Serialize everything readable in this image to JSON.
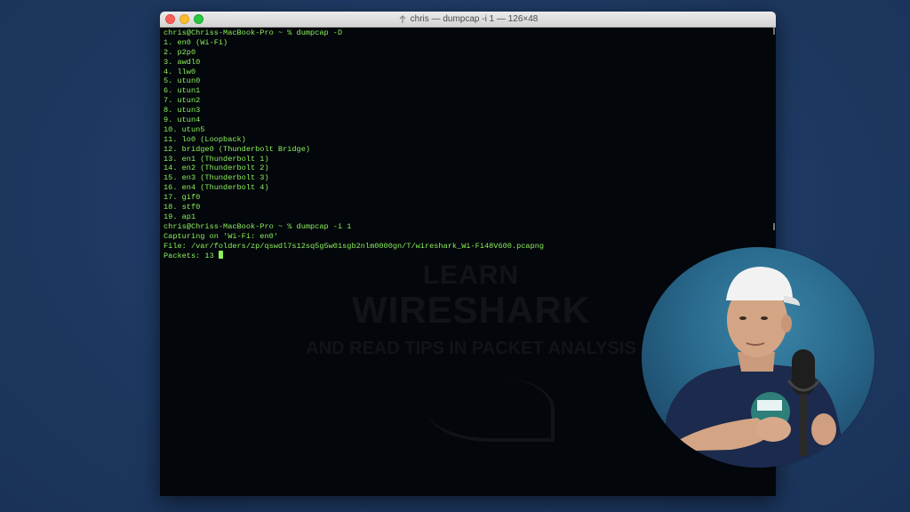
{
  "window": {
    "title": "chris — dumpcap -i 1 — 126×48"
  },
  "terminal": {
    "lines": [
      "chris@Chriss-MacBook-Pro ~ % dumpcap -D",
      "1. en0 (Wi-Fi)",
      "2. p2p0",
      "3. awdl0",
      "4. llw0",
      "5. utun0",
      "6. utun1",
      "7. utun2",
      "8. utun3",
      "9. utun4",
      "10. utun5",
      "11. lo0 (Loopback)",
      "12. bridge0 (Thunderbolt Bridge)",
      "13. en1 (Thunderbolt 1)",
      "14. en2 (Thunderbolt 2)",
      "15. en3 (Thunderbolt 3)",
      "16. en4 (Thunderbolt 4)",
      "17. gif0",
      "18. stf0",
      "19. ap1",
      "chris@Chriss-MacBook-Pro ~ % dumpcap -i 1",
      "Capturing on 'Wi-Fi: en0'",
      "File: /var/folders/zp/qswdl7s12sq5g5w01sgb2nlm0000gn/T/wireshark_Wi-Fi48V600.pcapng",
      "Packets: 13 "
    ]
  },
  "watermark": {
    "line1": "LEARN",
    "line2": "WIRESHARK",
    "line3": "AND READ TIPS IN PACKET ANALYSIS"
  },
  "colors": {
    "terminal_text": "#8bf15c",
    "terminal_bg": "#03060a",
    "desktop_bg": "#1f3a63"
  },
  "icons": {
    "title_icon": "folder-arrow-icon"
  }
}
